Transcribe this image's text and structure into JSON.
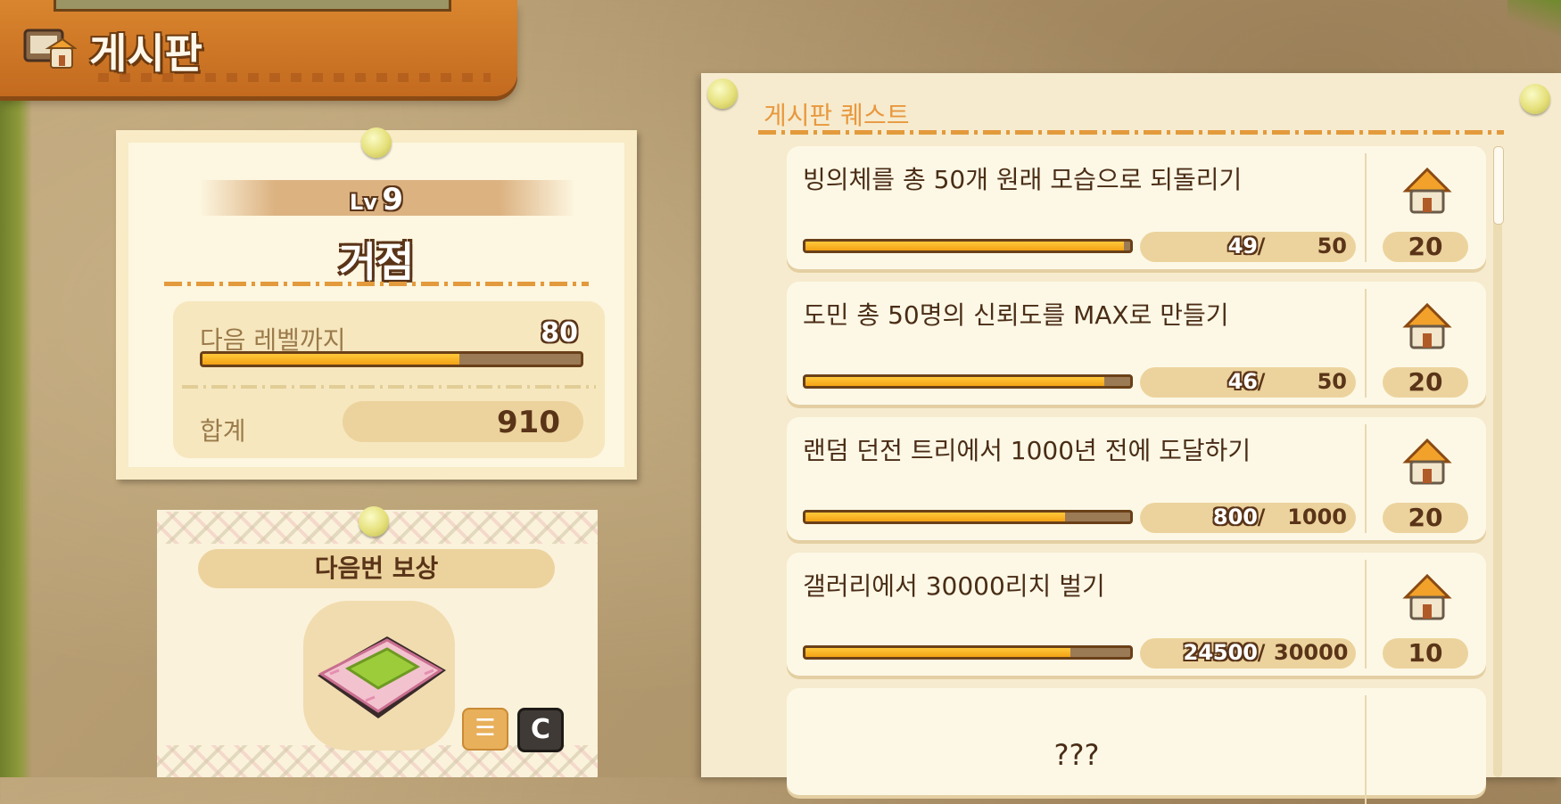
{
  "header": {
    "title": "게시판",
    "icon": "bulletin-board-icon"
  },
  "level_card": {
    "level_prefix": "Lv",
    "level": "9",
    "name": "거점",
    "next_level_label": "다음 레벨까지",
    "next_level_value": "80",
    "progress_fraction": 0.68,
    "total_label": "합계",
    "total_value": "910"
  },
  "reward_card": {
    "title": "다음번 보상",
    "item_icon": "carpet-rug-icon",
    "list_icon": "list-icon",
    "c_button": "C"
  },
  "quest_panel": {
    "title": "게시판 퀘스트",
    "quests": [
      {
        "text": "빙의체를 총 50개 원래 모습으로 되돌리기",
        "current": "49",
        "goal": "50",
        "reward": "20",
        "progress": 0.98
      },
      {
        "text": "도민 총 50명의 신뢰도를 MAX로 만들기",
        "current": "46",
        "goal": "50",
        "reward": "20",
        "progress": 0.92
      },
      {
        "text": "랜덤 던전 트리에서 1000년 전에 도달하기",
        "current": "800",
        "goal": "1000",
        "reward": "20",
        "progress": 0.8
      },
      {
        "text": "갤러리에서 30000리치 벌기",
        "current": "24500",
        "goal": "30000",
        "reward": "10",
        "progress": 0.817
      }
    ],
    "slash": "/",
    "locked_text": "???"
  },
  "colors": {
    "accent_orange": "#e8983e",
    "bar_fill": "#f3a215",
    "dark_brown": "#5a3418"
  }
}
